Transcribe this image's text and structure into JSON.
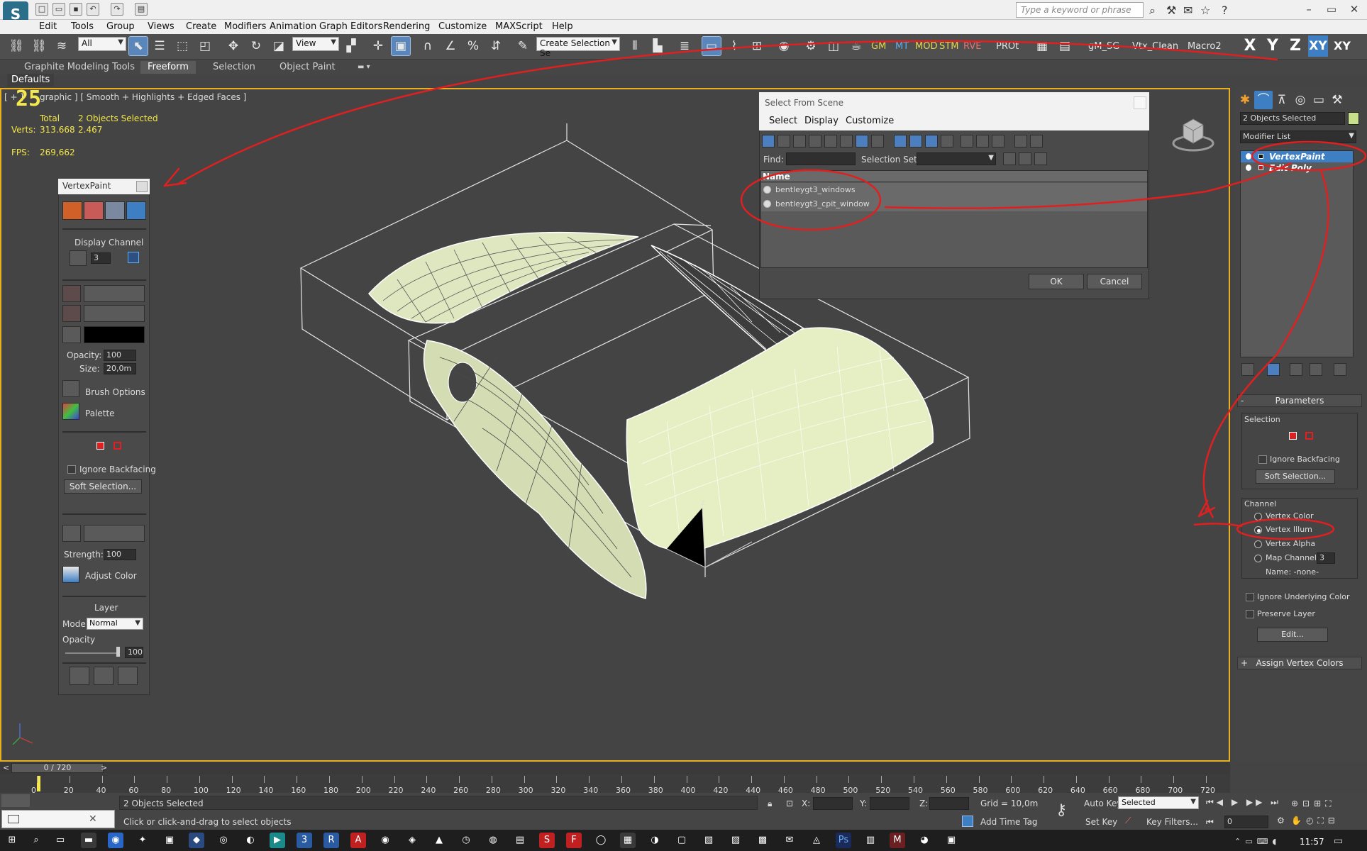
{
  "app": {
    "logo": "S",
    "search_placeholder": "Type a keyword or phrase"
  },
  "menu": [
    "Edit",
    "Tools",
    "Group",
    "Views",
    "Create",
    "Modifiers",
    "Animation",
    "Graph Editors",
    "Rendering",
    "Customize",
    "MAXScript",
    "Help"
  ],
  "toolbar": {
    "filter_value": "All",
    "refcoord_value": "View",
    "selset_value": "Create Selection Se",
    "text_buttons": [
      "GM",
      "MT",
      "MOD",
      "STM",
      "RVE",
      "PROt",
      "gM_SG",
      "Vtx_Clean",
      "Macro2"
    ],
    "axis": [
      "X",
      "Y",
      "Z",
      "XY",
      "XY"
    ]
  },
  "ribbon": {
    "tabs": [
      "Graphite Modeling Tools",
      "Freeform",
      "Selection",
      "Object Paint"
    ],
    "active_tab": "Freeform",
    "defaults": "Defaults"
  },
  "viewport": {
    "label_prefix": "[ + ]",
    "label": "graphic ] [ Smooth + Highlights + Edged Faces ]",
    "big_number": "25",
    "stats": {
      "total_label": "Total",
      "selected_label": "2 Objects Selected",
      "verts_label": "Verts:",
      "verts_total": "313.668",
      "verts_selected": "2.467",
      "fps_label": "FPS:",
      "fps_value": "269,662"
    }
  },
  "vertexpaint": {
    "title": "VertexPaint",
    "display_channel_label": "Display Channel",
    "display_channel_value": "3",
    "opacity_label": "Opacity:",
    "opacity_value": "100",
    "size_label": "Size:",
    "size_value": "20,0m",
    "brush_options": "Brush Options",
    "palette": "Palette",
    "ignore_backfacing": "Ignore Backfacing",
    "soft_selection": "Soft Selection...",
    "strength_label": "Strength:",
    "strength_value": "100",
    "adjust_color": "Adjust Color",
    "layer_label": "Layer",
    "mode_label": "Mode:",
    "mode_value": "Normal",
    "layer_opacity_label": "Opacity",
    "layer_opacity_value": "100",
    "paint_color": "#000000"
  },
  "select_dialog": {
    "title": "Select From Scene",
    "menu": [
      "Select",
      "Display",
      "Customize"
    ],
    "find_label": "Find:",
    "find_value": "",
    "selection_set_label": "Selection Set:",
    "column_name": "Name",
    "items": [
      "bentleygt3_windows",
      "bentleygt3_cpit_window"
    ],
    "ok": "OK",
    "cancel": "Cancel"
  },
  "command_panel": {
    "object_name": "2 Objects Selected",
    "modifier_list": "Modifier List",
    "stack": [
      "VertexPaint",
      "Edit Poly"
    ],
    "parameters": "Parameters",
    "selection_label": "Selection",
    "ignore_backfacing": "Ignore Backfacing",
    "soft_selection": "Soft Selection...",
    "channel_label": "Channel",
    "channels": [
      "Vertex Color",
      "Vertex Illum",
      "Vertex Alpha",
      "Map Channel"
    ],
    "active_channel": "Vertex Illum",
    "map_channel_value": "3",
    "name_line": "Name: -none-",
    "ignore_underlying": "Ignore Underlying Color",
    "preserve_layer": "Preserve Layer",
    "edit": "Edit...",
    "assign_vertex_colors": "Assign Vertex Colors",
    "object_color": "#c8e08a"
  },
  "timeline": {
    "frame_display": "0 / 720",
    "ticks": [
      "0",
      "20",
      "40",
      "60",
      "80",
      "100",
      "120",
      "140",
      "160",
      "180",
      "200",
      "220",
      "240",
      "260",
      "280",
      "300",
      "320",
      "340",
      "360",
      "380",
      "400",
      "420",
      "440",
      "460",
      "480",
      "500",
      "520",
      "540",
      "560",
      "580",
      "600",
      "620",
      "640",
      "660",
      "680",
      "700",
      "720"
    ]
  },
  "status": {
    "selected": "2 Objects Selected",
    "prompt": "Click or click-and-drag to select objects",
    "x_label": "X:",
    "y_label": "Y:",
    "z_label": "Z:",
    "grid": "Grid = 10,0m",
    "add_time_tag": "Add Time Tag",
    "auto_key": "Auto Key",
    "auto_key_value": "Selected",
    "set_key": "Set Key",
    "key_filters": "Key Filters...",
    "frame_value": "0"
  },
  "taskbar": {
    "clock": "11:57"
  },
  "colors": {
    "annotation": "#e02020",
    "viewport_border": "#e8b020",
    "highlight": "#3e7fc4"
  }
}
